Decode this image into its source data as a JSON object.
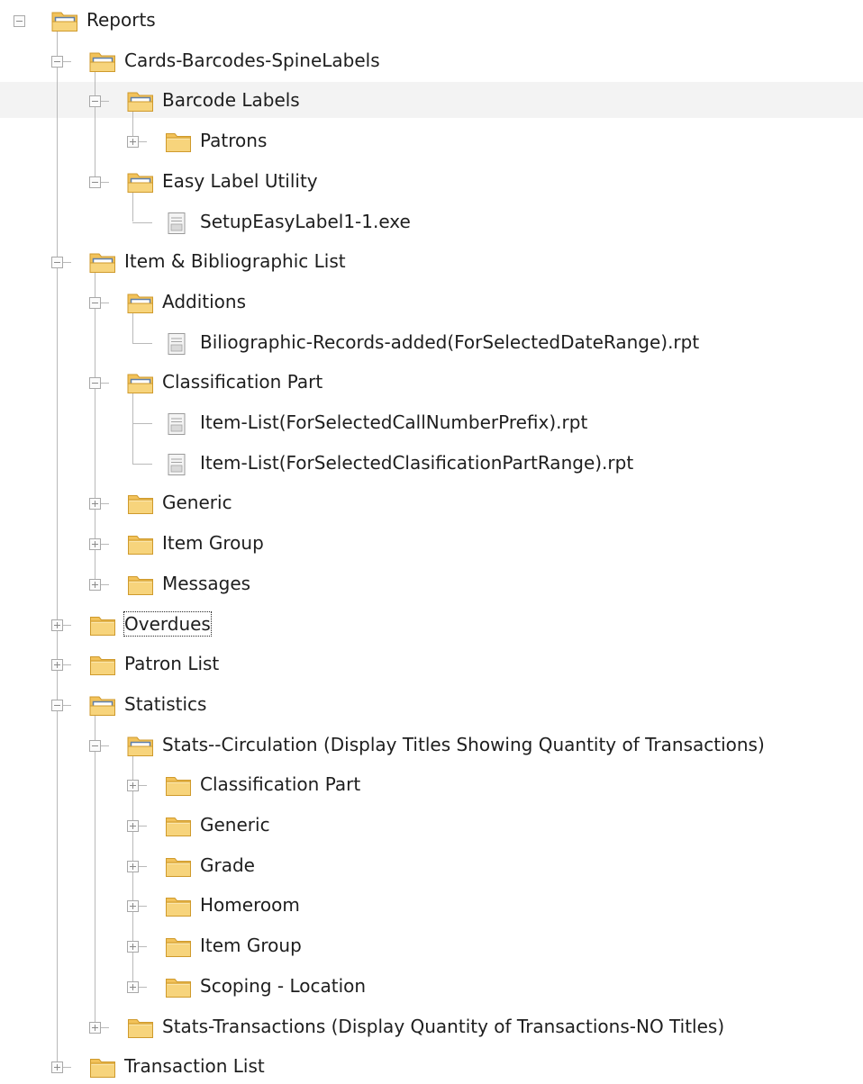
{
  "tree": {
    "nodes": [
      {
        "id": "reports",
        "label": "Reports",
        "level": 0,
        "type": "folder",
        "expanded": true
      },
      {
        "id": "cards",
        "label": "Cards-Barcodes-SpineLabels",
        "level": 1,
        "type": "folder",
        "expanded": true
      },
      {
        "id": "barcode-labels",
        "label": "Barcode Labels",
        "level": 2,
        "type": "folder",
        "expanded": true,
        "highlighted": true
      },
      {
        "id": "patrons",
        "label": "Patrons",
        "level": 3,
        "type": "folder",
        "expanded": false
      },
      {
        "id": "easy-label",
        "label": "Easy Label Utility",
        "level": 2,
        "type": "folder",
        "expanded": true
      },
      {
        "id": "setup-easy-label",
        "label": "SetupEasyLabel1-1.exe",
        "level": 3,
        "type": "file"
      },
      {
        "id": "item-bib-list",
        "label": "Item & Bibliographic List",
        "level": 1,
        "type": "folder",
        "expanded": true
      },
      {
        "id": "additions",
        "label": "Additions",
        "level": 2,
        "type": "folder",
        "expanded": true
      },
      {
        "id": "bib-records-added",
        "label": "Biliographic-Records-added(ForSelectedDateRange).rpt",
        "level": 3,
        "type": "file"
      },
      {
        "id": "classification-part",
        "label": "Classification Part",
        "level": 2,
        "type": "folder",
        "expanded": true
      },
      {
        "id": "item-list-callnumber",
        "label": "Item-List(ForSelectedCallNumberPrefix).rpt",
        "level": 3,
        "type": "file"
      },
      {
        "id": "item-list-classification",
        "label": "Item-List(ForSelectedClasificationPartRange).rpt",
        "level": 3,
        "type": "file"
      },
      {
        "id": "generic",
        "label": "Generic",
        "level": 2,
        "type": "folder",
        "expanded": false
      },
      {
        "id": "item-group",
        "label": "Item Group",
        "level": 2,
        "type": "folder",
        "expanded": false
      },
      {
        "id": "messages",
        "label": "Messages",
        "level": 2,
        "type": "folder",
        "expanded": false
      },
      {
        "id": "overdues",
        "label": "Overdues",
        "level": 1,
        "type": "folder",
        "expanded": false,
        "focused": true
      },
      {
        "id": "patron-list",
        "label": "Patron List",
        "level": 1,
        "type": "folder",
        "expanded": false
      },
      {
        "id": "statistics",
        "label": "Statistics",
        "level": 1,
        "type": "folder",
        "expanded": true
      },
      {
        "id": "stats-circulation",
        "label": "Stats--Circulation (Display Titles Showing Quantity of Transactions)",
        "level": 2,
        "type": "folder",
        "expanded": true
      },
      {
        "id": "sc-classification-part",
        "label": "Classification Part",
        "level": 3,
        "type": "folder",
        "expanded": false
      },
      {
        "id": "sc-generic",
        "label": "Generic",
        "level": 3,
        "type": "folder",
        "expanded": false
      },
      {
        "id": "sc-grade",
        "label": "Grade",
        "level": 3,
        "type": "folder",
        "expanded": false
      },
      {
        "id": "sc-homeroom",
        "label": "Homeroom",
        "level": 3,
        "type": "folder",
        "expanded": false
      },
      {
        "id": "sc-item-group",
        "label": "Item Group",
        "level": 3,
        "type": "folder",
        "expanded": false
      },
      {
        "id": "sc-scoping-location",
        "label": "Scoping - Location",
        "level": 3,
        "type": "folder",
        "expanded": false
      },
      {
        "id": "stats-transactions",
        "label": "Stats-Transactions (Display Quantity of Transactions-NO Titles)",
        "level": 2,
        "type": "folder",
        "expanded": false
      },
      {
        "id": "transaction-list",
        "label": "Transaction List",
        "level": 1,
        "type": "folder",
        "expanded": false
      }
    ]
  },
  "colors": {
    "folder_body": "#f7d47c",
    "folder_tab": "#f2c25a",
    "folder_edge": "#cf9a2c",
    "folder_open_inner": "#5f7ea6",
    "tree_line": "#b9b9b9",
    "highlight_row": "#f3f3f3"
  },
  "icons": {
    "folder_closed": "folder-icon",
    "folder_open": "folder-open-icon",
    "file": "report-file-icon",
    "expand": "plus-box-icon",
    "collapse": "minus-box-icon"
  }
}
